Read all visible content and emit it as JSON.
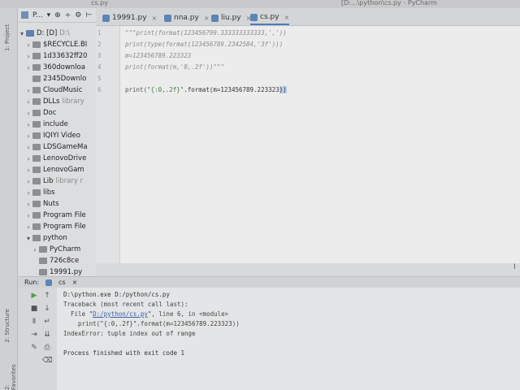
{
  "titlebar": {
    "left": "cs.py",
    "right": "[D:...\\python\\cs.py - PyCharm"
  },
  "sidebar": {
    "project_label": "1: Project",
    "structure_label": "2: Structure",
    "favorites_label": "2: Favorites"
  },
  "project": {
    "selector": "P...",
    "tree": [
      {
        "label": "D: [D]",
        "extra": "D:\\",
        "arrow": "▾",
        "indent": 0,
        "blue": true
      },
      {
        "label": "$RECYCLE.BI",
        "arrow": "›",
        "indent": 1
      },
      {
        "label": "1d33632ff20",
        "arrow": "›",
        "indent": 1
      },
      {
        "label": "360downloa",
        "arrow": "›",
        "indent": 1
      },
      {
        "label": "2345Downlo",
        "arrow": "",
        "indent": 1
      },
      {
        "label": "CloudMusic",
        "arrow": "›",
        "indent": 1
      },
      {
        "label": "DLLs",
        "extra": "library",
        "arrow": "›",
        "indent": 1
      },
      {
        "label": "Doc",
        "arrow": "›",
        "indent": 1
      },
      {
        "label": "include",
        "arrow": "›",
        "indent": 1
      },
      {
        "label": "IQIYI Video",
        "arrow": "›",
        "indent": 1
      },
      {
        "label": "LDSGameMa",
        "arrow": "›",
        "indent": 1
      },
      {
        "label": "LenovoDrive",
        "arrow": "›",
        "indent": 1
      },
      {
        "label": "LenovoGam",
        "arrow": "›",
        "indent": 1
      },
      {
        "label": "Lib",
        "extra": "library r",
        "arrow": "›",
        "indent": 1
      },
      {
        "label": "libs",
        "arrow": "›",
        "indent": 1
      },
      {
        "label": "Nuts",
        "arrow": "›",
        "indent": 1
      },
      {
        "label": "Program File",
        "arrow": "›",
        "indent": 1
      },
      {
        "label": "Program File",
        "arrow": "›",
        "indent": 1
      },
      {
        "label": "python",
        "arrow": "▾",
        "indent": 1
      },
      {
        "label": "PyCharm",
        "arrow": "›",
        "indent": 2
      },
      {
        "label": "726c8ce",
        "arrow": "",
        "indent": 2
      },
      {
        "label": "19991.py",
        "arrow": "",
        "indent": 2
      }
    ]
  },
  "tabs": [
    {
      "label": "19991.py",
      "active": false
    },
    {
      "label": "nna.py",
      "active": false
    },
    {
      "label": "liu.py",
      "active": false
    },
    {
      "label": "cs.py",
      "active": true
    }
  ],
  "code_lines": [
    {
      "n": "1",
      "text": "\"\"\"print(format(123456799.333333333333,','))",
      "live": false
    },
    {
      "n": "2",
      "text": "print(type(format(123456789.2342584,'3f')))",
      "live": false
    },
    {
      "n": "3",
      "text": "m=123456789.223323",
      "live": false
    },
    {
      "n": "4",
      "text": "print(format(m,'0,.2f'))\"\"\"",
      "live": false
    },
    {
      "n": "5",
      "text": "",
      "live": false
    },
    {
      "n": "6",
      "text": "",
      "live": true
    }
  ],
  "line6": {
    "pre": "print(",
    "str": "\"{:0,.2f}\"",
    "mid": ".format(",
    "arg": "m=123456789.223323",
    "post": "))"
  },
  "run": {
    "label": "Run:",
    "tab": "cs",
    "console": {
      "cmd": "D:\\python.exe D:/python/cs.py",
      "tb": "Traceback (most recent call last):",
      "file_pre": "  File \"",
      "file_link": "D:/python/cs.py",
      "file_post": "\", line 6, in <module>",
      "src": "    print(\"{:0,.2f}\".format(m=123456789.223323))",
      "err": "IndexError: tuple index out of range",
      "done": "Process finished with exit code 1"
    }
  }
}
